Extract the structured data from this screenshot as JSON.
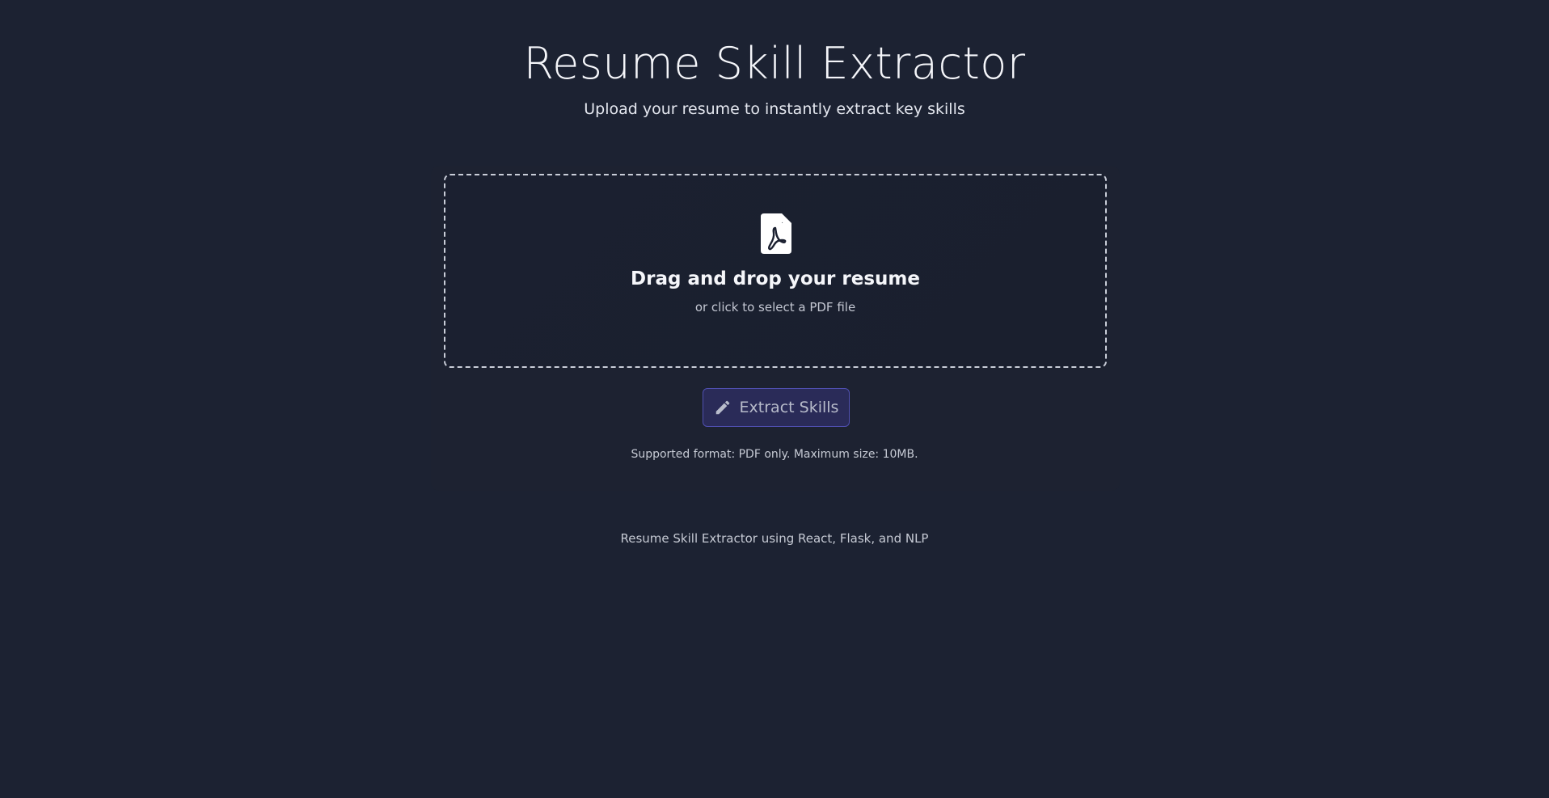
{
  "header": {
    "title": "Resume Skill Extractor",
    "subtitle": "Upload your resume to instantly extract key skills"
  },
  "upload": {
    "icon": "pdf-file-icon",
    "title": "Drag and drop your resume",
    "hint": "or click to select a PDF file"
  },
  "action": {
    "icon": "pencil-icon",
    "label": "Extract Skills"
  },
  "note": "Supported format: PDF only. Maximum size: 10MB.",
  "footer": "Resume Skill Extractor using React, Flask, and NLP",
  "colors": {
    "background": "#1c2232",
    "button_bg": "#2a2b58",
    "button_border": "#4f4fb0"
  }
}
